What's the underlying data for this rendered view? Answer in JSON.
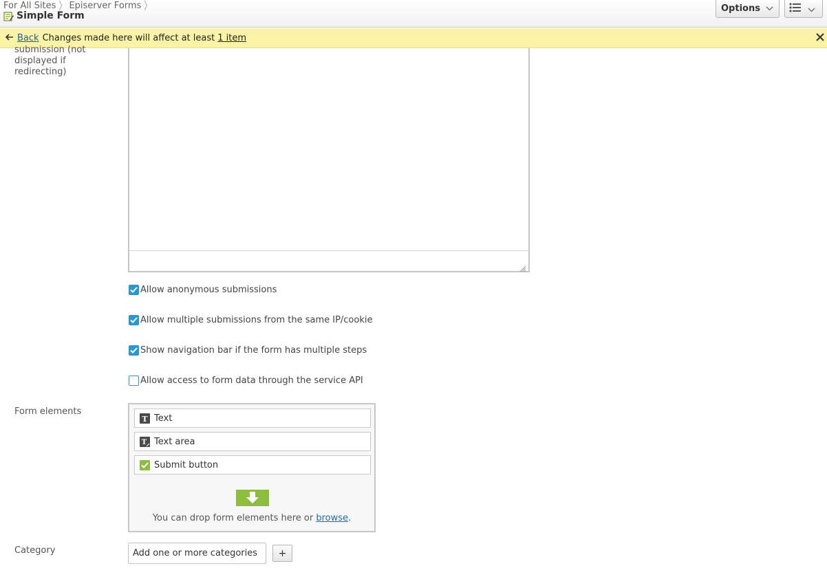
{
  "header": {
    "breadcrumb": [
      "For All Sites",
      "Episerver Forms"
    ],
    "title": "Simple Form",
    "options_label": "Options",
    "icons": {
      "form": "form-edit-icon",
      "options_chevron": "chevron-down-icon",
      "view": "list-view-icon"
    }
  },
  "notice": {
    "back_label": "Back",
    "message": "Changes made here will affect at least",
    "item_link": "1 item",
    "colors": {
      "background": "#fbf3a6",
      "link": "#1b5fa8"
    }
  },
  "fields": {
    "submission_label": "submission (not displayed if redirecting)",
    "form_elements_label": "Form elements",
    "category_label": "Category"
  },
  "checkboxes": [
    {
      "label": "Allow anonymous submissions",
      "checked": true
    },
    {
      "label": "Allow multiple submissions from the same IP/cookie",
      "checked": true
    },
    {
      "label": "Show navigation bar if the form has multiple steps",
      "checked": true
    },
    {
      "label": "Allow access to form data through the service API",
      "checked": false
    }
  ],
  "form_elements": [
    {
      "label": "Text",
      "icon": "text-icon"
    },
    {
      "label": "Text area",
      "icon": "textarea-icon"
    },
    {
      "label": "Submit button",
      "icon": "submit-check-icon"
    }
  ],
  "drop_zone": {
    "text": "You can drop form elements here or",
    "browse_link": "browse",
    "suffix": "."
  },
  "category": {
    "button_label": "Add one or more categories",
    "plus_label": "+"
  },
  "colors": {
    "accent": "#2996d6",
    "drop_arrow": "#8cbd3f",
    "submit_icon": "#8cbd3f"
  }
}
